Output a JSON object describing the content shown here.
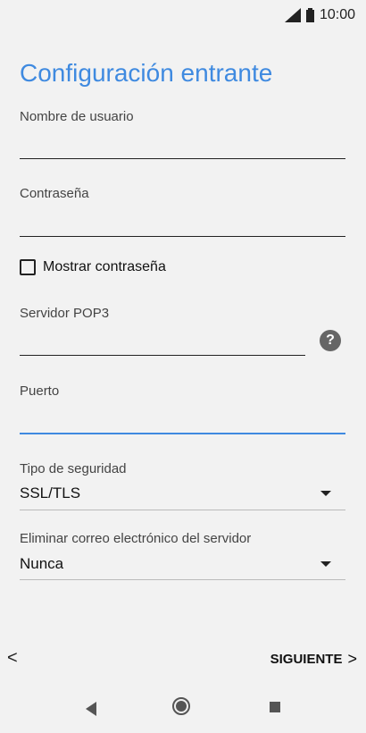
{
  "status": {
    "time": "10:00",
    "signal_icon": "signal-icon",
    "battery_icon": "battery-icon"
  },
  "title": "Configuración entrante",
  "fields": {
    "username_label": "Nombre de usuario",
    "password_label": "Contraseña",
    "show_password_label": "Mostrar contraseña",
    "server_label": "Servidor POP3",
    "port_label": "Puerto",
    "security_label": "Tipo de seguridad",
    "security_value": "SSL/TLS",
    "delete_label": "Eliminar correo electrónico del servidor",
    "delete_value": "Nunca"
  },
  "help_icon": "?",
  "footer": {
    "back_icon": "<",
    "next_label": "SIGUIENTE",
    "next_icon": ">"
  },
  "colors": {
    "accent": "#3f8ae0",
    "background": "#f2f2f2"
  }
}
